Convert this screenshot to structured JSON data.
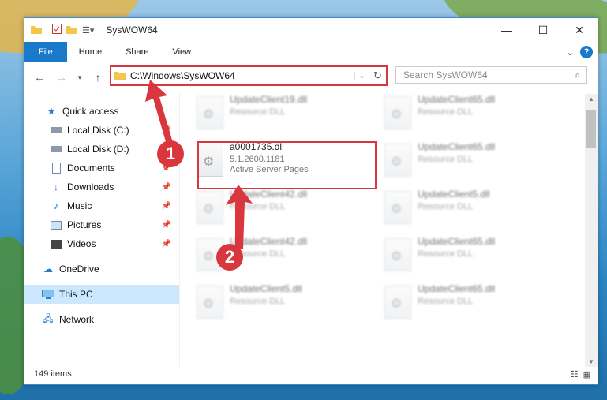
{
  "window": {
    "title": "SysWOW64",
    "controls": {
      "minimize": "—",
      "maximize": "☐",
      "close": "✕"
    }
  },
  "ribbon": {
    "tabs": [
      "File",
      "Home",
      "Share",
      "View"
    ],
    "help": "?"
  },
  "address": {
    "path": "C:\\Windows\\SysWOW64"
  },
  "search": {
    "placeholder": "Search SysWOW64"
  },
  "sidebar": {
    "items": [
      {
        "label": "Quick access",
        "icon": "star-icon"
      },
      {
        "label": "Local Disk (C:)",
        "icon": "drive-icon"
      },
      {
        "label": "Local Disk (D:)",
        "icon": "drive-icon"
      },
      {
        "label": "Documents",
        "icon": "documents-icon"
      },
      {
        "label": "Downloads",
        "icon": "download-icon"
      },
      {
        "label": "Music",
        "icon": "music-icon"
      },
      {
        "label": "Pictures",
        "icon": "pictures-icon"
      },
      {
        "label": "Videos",
        "icon": "videos-icon"
      },
      {
        "label": "OneDrive",
        "icon": "cloud-icon"
      },
      {
        "label": "This PC",
        "icon": "computer-icon"
      },
      {
        "label": "Network",
        "icon": "network-icon"
      }
    ]
  },
  "files": [
    {
      "name": "UpdateClient19.dll",
      "type": "Resource DLL"
    },
    {
      "name": "UpdateClient65.dll",
      "type": "Resource DLL"
    },
    {
      "name": "UpdateClient65.dll",
      "type": "Resource DLL"
    },
    {
      "name": "UpdateClient5.dll",
      "type": "Resource DLL"
    },
    {
      "name": "UpdateClient42.dll",
      "type": "Resource DLL"
    },
    {
      "name": "UpdateClient42.dll",
      "type": "Resource DLL"
    },
    {
      "name": "UpdateClient65.dll",
      "type": "Resource DLL"
    },
    {
      "name": "UpdateClient5.dll",
      "type": "Resource DLL"
    },
    {
      "name": "UpdateClient65.dll",
      "type": "Resource DLL"
    }
  ],
  "highlighted_file": {
    "name": "a0001735.dll",
    "version": "5.1.2600.1181",
    "description": "Active Server Pages"
  },
  "status": {
    "item_count": "149 items"
  },
  "annotations": {
    "step1": "1",
    "step2": "2"
  },
  "colors": {
    "accent": "#1979ca",
    "highlight": "#d9363e",
    "selected": "#cce8ff"
  }
}
